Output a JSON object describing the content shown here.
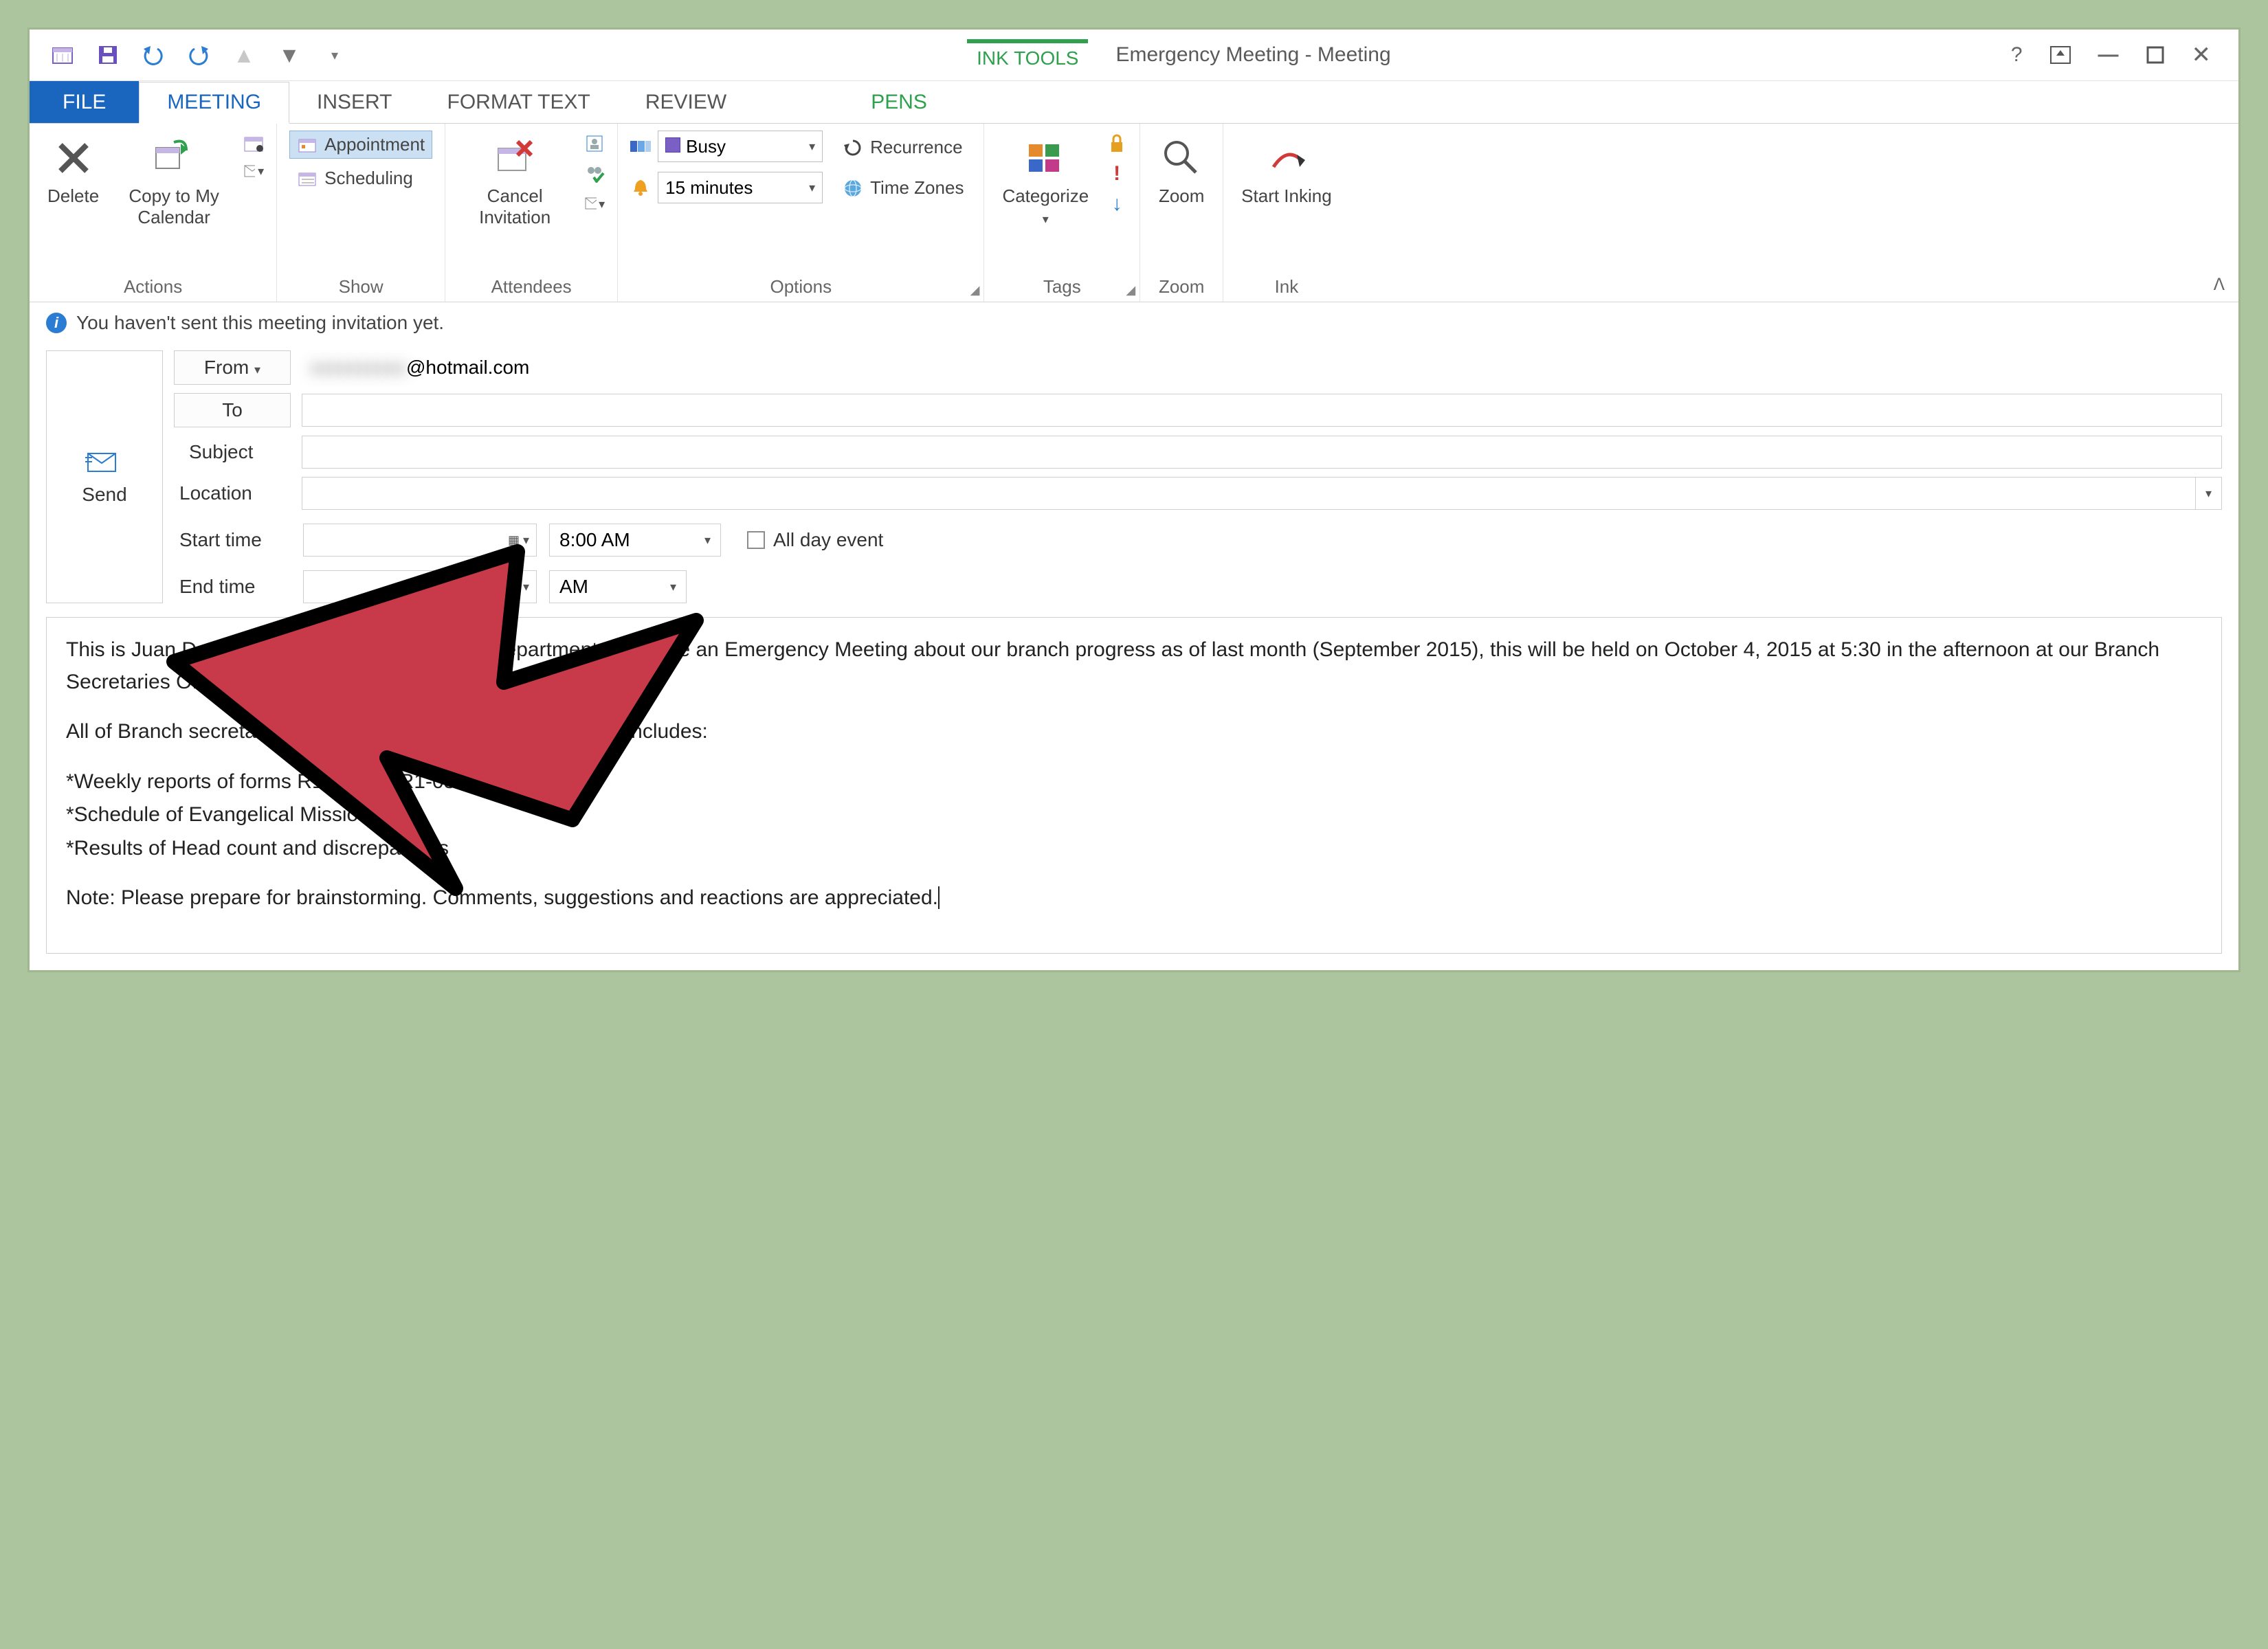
{
  "titlebar": {
    "ink_tools": "INK TOOLS",
    "doc_title": "Emergency Meeting - Meeting"
  },
  "tabs": {
    "file": "FILE",
    "meeting": "MEETING",
    "insert": "INSERT",
    "format_text": "FORMAT TEXT",
    "review": "REVIEW",
    "pens": "PENS"
  },
  "ribbon": {
    "actions": {
      "label": "Actions",
      "delete": "Delete",
      "copy_to_my_calendar": "Copy to My Calendar"
    },
    "show": {
      "label": "Show",
      "appointment": "Appointment",
      "scheduling": "Scheduling"
    },
    "attendees": {
      "label": "Attendees",
      "cancel_invitation": "Cancel Invitation"
    },
    "options": {
      "label": "Options",
      "busy": "Busy",
      "reminder": "15 minutes",
      "recurrence": "Recurrence",
      "time_zones": "Time Zones"
    },
    "tags": {
      "label": "Tags",
      "categorize": "Categorize"
    },
    "zoom": {
      "label": "Zoom",
      "zoom": "Zoom"
    },
    "ink": {
      "label": "Ink",
      "start_inking": "Start Inking"
    }
  },
  "infobar": {
    "text": "You haven't sent this meeting invitation yet."
  },
  "compose": {
    "send": "Send",
    "from_label": "From",
    "from_value": "@hotmail.com",
    "to_label": "To",
    "subject_label": "Subject",
    "location_label": "Location",
    "start_label": "Start time",
    "end_label": "End time",
    "start_time": "8:00 AM",
    "end_time": "AM",
    "all_day": "All day event"
  },
  "body": {
    "p1": "This is Juan D. Smith Local Secretary of KHM Department. We have an Emergency Meeting about our branch progress as of last month (September 2015), this will be held on October 4, 2015 at 5:30 in the afternoon at our Branch Secretaries Office.",
    "p2": "All of Branch secretaries are expected to attend, Our agenda includes:",
    "b1": "*Weekly reports of forms R1-05 and R1-03.",
    "b2": "*Schedule of Evangelical Missions.",
    "b3": "*Results of Head count and discrepancies",
    "note": "Note: Please prepare for brainstorming. Comments, suggestions and reactions are appreciated."
  }
}
